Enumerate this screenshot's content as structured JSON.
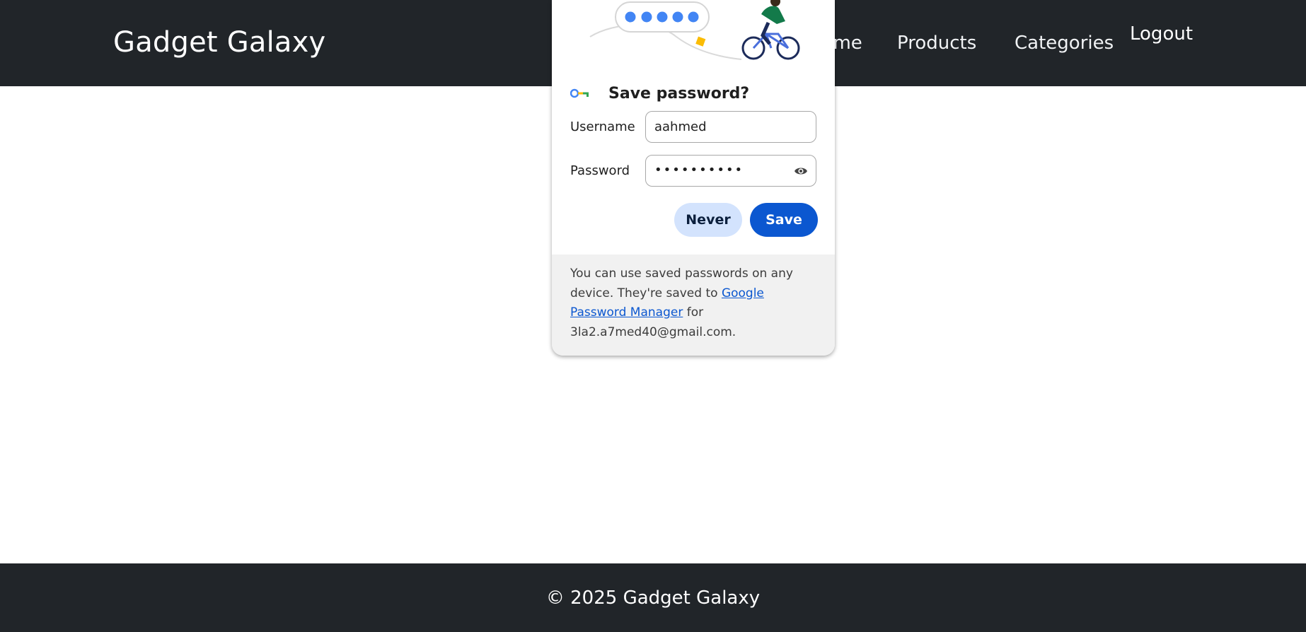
{
  "navbar": {
    "brand": "Gadget Galaxy",
    "links": {
      "home": "Home",
      "products": "Products",
      "categories": "Categories"
    },
    "logout": "Logout"
  },
  "password_prompt": {
    "title": "Save password?",
    "username_label": "Username",
    "username_value": "aahmed",
    "password_label": "Password",
    "password_masked": "••••••••••",
    "never_label": "Never",
    "save_label": "Save",
    "note_part1": "You can use saved passwords on any device. They're saved to ",
    "note_link": "Google Password Manager",
    "note_part2": " for 3la2.a7med40@gmail.com.",
    "icons": {
      "key": "key-icon",
      "eye": "eye-icon"
    },
    "colors": {
      "save_button": "#0b57d0",
      "never_button": "#d3e3fd"
    }
  },
  "footer": {
    "copyright": "© 2025 Gadget Galaxy"
  },
  "colors": {
    "navbar_bg": "#212529"
  }
}
